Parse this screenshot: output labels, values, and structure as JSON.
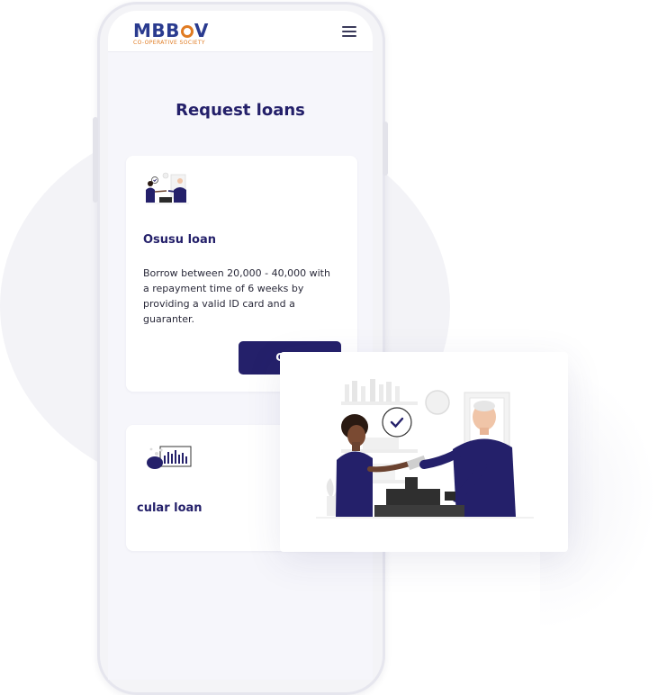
{
  "colors": {
    "primary": "#24206a",
    "accent": "#e07b22",
    "logo_blue": "#2a3b8f",
    "background": "#f6f6fb"
  },
  "header": {
    "logo_text_a": "MBB",
    "logo_text_b": "V",
    "logo_subtitle": "CO-OPERATIVE SOCIETY",
    "menu_icon": "hamburger-icon"
  },
  "page": {
    "title": "Request loans"
  },
  "loans": [
    {
      "title": "Osusu loan",
      "description": "Borrow between 20,000 - 40,000 with a repayment time of 6 weeks by providing a valid ID card and a guaranter.",
      "button_label": "Cred",
      "illustration": "cashier-handshake-illustration"
    },
    {
      "title": "cular loan",
      "illustration": "piggy-bank-chart-illustration"
    }
  ],
  "floating_card": {
    "illustration": "cashier-handshake-illustration-large",
    "check_icon": "check-icon"
  }
}
